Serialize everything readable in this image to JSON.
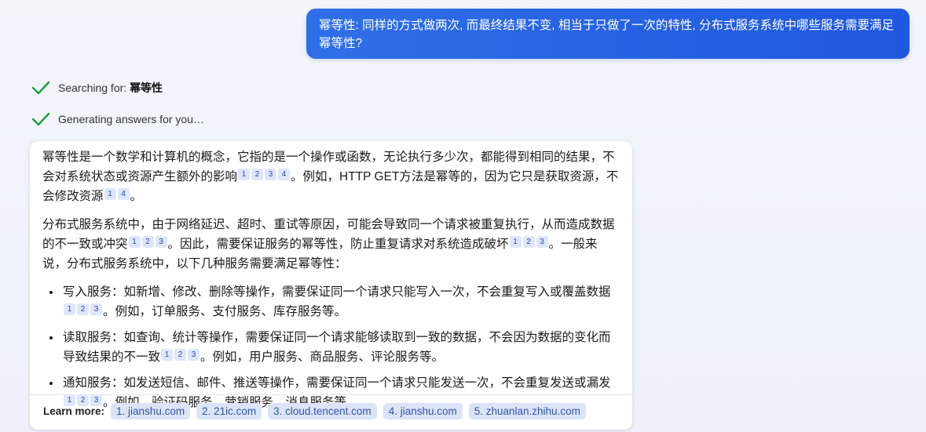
{
  "user_message": "幂等性: 同样的方式做两次, 而最终结果不变, 相当于只做了一次的特性, 分布式服务系统中哪些服务需要满足幂等性?",
  "status": {
    "searching_prefix": "Searching for: ",
    "searching_query": "幂等性",
    "generating": "Generating answers for you…"
  },
  "answer": {
    "p1": {
      "a": "幂等性是一个数学和计算机的概念，它指的是一个操作或函数，无论执行多少次，都能得到相同的结果，不会对系统状态或资源产生额外的影响",
      "b": "。例如，HTTP GET方法是幂等的，因为它只是获取资源，不会修改资源",
      "c": "。"
    },
    "p2": {
      "a": "分布式服务系统中，由于网络延迟、超时、重试等原因，可能会导致同一个请求被重复执行，从而造成数据的不一致或冲突",
      "b": "。因此，需要保证服务的幂等性，防止重复请求对系统造成破坏",
      "c": "。一般来说，分布式服务系统中，以下几种服务需要满足幂等性："
    },
    "items": [
      {
        "a": "写入服务：如新增、修改、删除等操作，需要保证同一个请求只能写入一次，不会重复写入或覆盖数据",
        "b": "。例如，订单服务、支付服务、库存服务等。"
      },
      {
        "a": "读取服务：如查询、统计等操作，需要保证同一个请求能够读取到一致的数据，不会因为数据的变化而导致结果的不一致",
        "b": "。例如，用户服务、商品服务、评论服务等。"
      },
      {
        "a": "通知服务：如发送短信、邮件、推送等操作，需要保证同一个请求只能发送一次，不会重复发送或漏发",
        "b": "。例如，验证码服务、营销服务、消息服务等。"
      }
    ]
  },
  "citations": [
    "1",
    "2",
    "3",
    "4"
  ],
  "learn_more": {
    "label": "Learn more:",
    "links": [
      "1. jianshu.com",
      "2. 21ic.com",
      "3. cloud.tencent.com",
      "4. jianshu.com",
      "5. zhuanlan.zhihu.com"
    ]
  },
  "colors": {
    "user_bubble": "#2563e8",
    "check": "#1e9e3e",
    "citation_bg": "#dde6fb",
    "link_bg": "#dbe3f7"
  }
}
